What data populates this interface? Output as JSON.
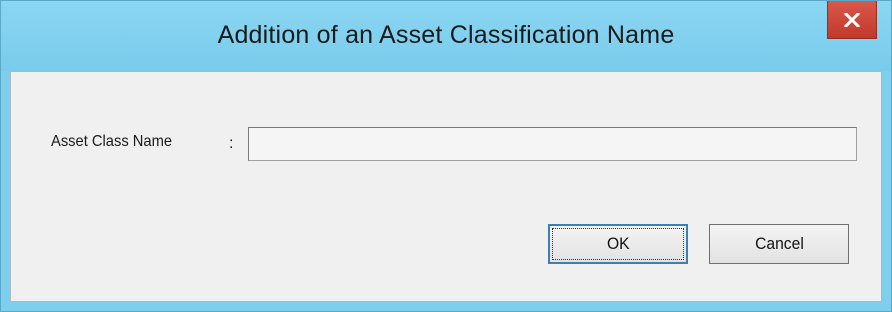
{
  "window": {
    "title": "Addition of an Asset Classification Name"
  },
  "form": {
    "asset_class_label": "Asset Class Name",
    "separator": ":",
    "asset_class_value": ""
  },
  "buttons": {
    "ok_label": "OK",
    "cancel_label": "Cancel"
  },
  "icons": {
    "close": "close-icon"
  },
  "colors": {
    "titlebar": "#7ecfee",
    "close_button": "#c9453a",
    "client_background": "#f0f0f0",
    "default_button_border": "#3c7fb1"
  }
}
